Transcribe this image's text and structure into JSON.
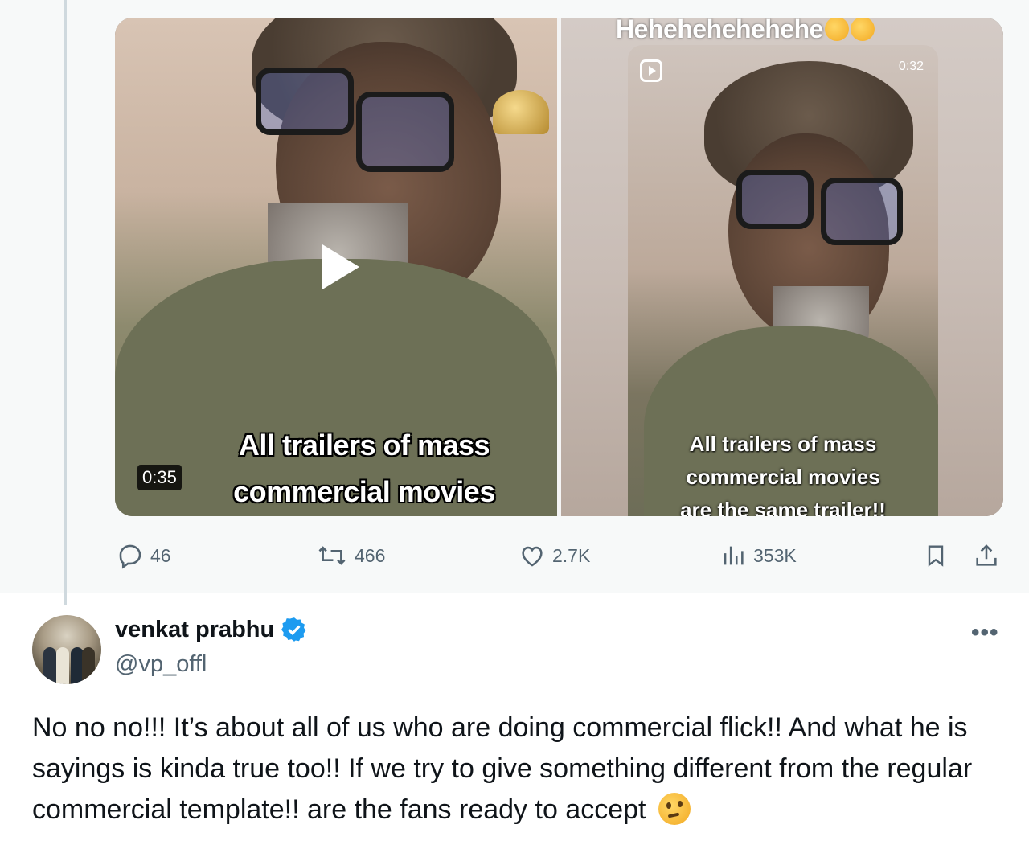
{
  "media": {
    "left_video": {
      "caption_line1": "All trailers of mass",
      "caption_line2": "commercial movies",
      "duration": "0:35"
    },
    "right_video": {
      "overlay_title": "Hehehehehehehe",
      "reel_time": "0:32",
      "caption_line1": "All trailers of mass",
      "caption_line2": "commercial movies",
      "caption_line3": "are the same trailer!!"
    }
  },
  "actions": {
    "replies": "46",
    "reposts": "466",
    "likes": "2.7K",
    "views": "353K"
  },
  "reply_tweet": {
    "display_name": "venkat prabhu",
    "handle": "@vp_offl",
    "more_label": "•••",
    "text": "No no no!!! It’s about all of us who are doing commercial flick!! And what he is sayings is kinda true too!! If we try to give something different from the regular commercial template!! are the fans ready to accept"
  },
  "colors": {
    "accent": "#1d9bf0",
    "secondary_text": "#536471",
    "primary_text": "#0f1419",
    "thread_line": "#cfd9de"
  },
  "icons": [
    "reply-icon",
    "repost-icon",
    "like-icon",
    "views-icon",
    "bookmark-icon",
    "share-icon",
    "verified-badge-icon",
    "play-icon",
    "reel-icon",
    "thinking-face-emoji"
  ]
}
